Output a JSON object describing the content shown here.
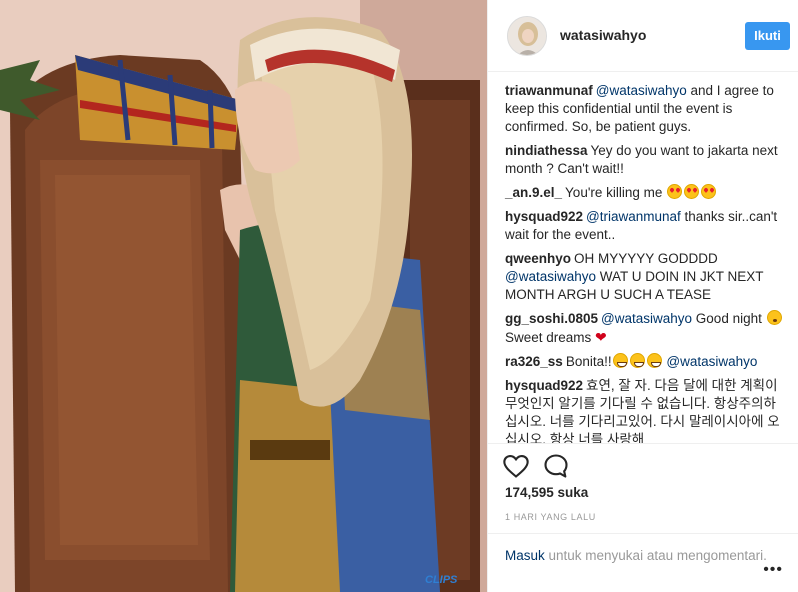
{
  "post": {
    "username": "watasiwahyo",
    "follow_label": "Ikuti",
    "likes": "174,595 suka",
    "time": "1 HARI YANG LALU",
    "photo_caption_tag": "CLIPS"
  },
  "comments": [
    {
      "user": "triawanmunaf",
      "mention": "@watasiwahyo",
      "text": " and I agree to keep this confidential until the event is confirmed. So, be patient guys."
    },
    {
      "user": "nindiathessa",
      "text": "Yey do you want to jakarta next month ? Can't wait!!"
    },
    {
      "user": "_an.9.el_",
      "text": "You're killing me "
    },
    {
      "user": "hysquad922",
      "mention": "@triawanmunaf",
      "text": " thanks sir..can't wait for the event.."
    },
    {
      "user": "qweenhyo",
      "text": "OH MYYYYY GODDDD ",
      "mention": "@watasiwahyo",
      "text2": " WAT U DOIN IN JKT NEXT MONTH ARGH U SUCH A TEASE"
    },
    {
      "user": "gg_soshi.0805",
      "mention": "@watasiwahyo",
      "text": " Good night ",
      "text2": " Sweet dreams "
    },
    {
      "user": "ra326_ss",
      "text": "Bonita!!",
      "mention": "@watasiwahyo"
    },
    {
      "user": "hysquad922",
      "text": "효연, 잘 자. 다음 달에 대한 계획이 무엇인지 알기를 기다릴 수 없습니다. 항상주의하십시오. 너를 기다리고있어. 다시 말레이시아에 오십시오. 항상 너를 사랑해"
    }
  ],
  "login": {
    "link": "Masuk",
    "text": " untuk menyukai atau mengomentari.",
    "more": "•••"
  },
  "colors": {
    "accent": "#3897f0",
    "mention": "#003569",
    "heart": "#d0021b"
  }
}
